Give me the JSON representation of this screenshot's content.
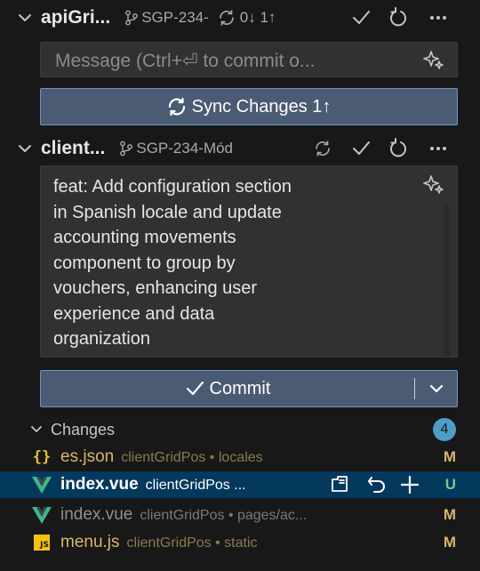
{
  "repos": [
    {
      "name": "apiGri...",
      "branch": "SGP-234-",
      "sync_status": "0↓ 1↑",
      "message_placeholder": "Message (Ctrl+⏎ to commit o...",
      "action_button": "Sync Changes 1↑"
    },
    {
      "name": "client...",
      "branch": "SGP-234-Mód",
      "message_lines": [
        "feat: Add configuration section",
        "in Spanish locale and update",
        "accounting movements",
        "component to group by",
        "vouchers, enhancing user",
        "experience and data",
        "organization"
      ],
      "action_button": "Commit"
    }
  ],
  "changes": {
    "label": "Changes",
    "count": "4",
    "files": [
      {
        "name": "es.json",
        "path": "clientGridPos • locales",
        "status": "M",
        "icon": "json-icon",
        "selected": false
      },
      {
        "name": "index.vue",
        "path": "clientGridPos ...",
        "status": "U",
        "icon": "vue-icon",
        "selected": true
      },
      {
        "name": "index.vue",
        "path": "clientGridPos • pages/ac...",
        "status": "M",
        "icon": "vue-icon",
        "selected": false
      },
      {
        "name": "menu.js",
        "path": "clientGridPos • static",
        "status": "M",
        "icon": "js-icon",
        "selected": false
      }
    ]
  },
  "colors": {
    "modified": "#d7b769",
    "untracked": "#74c991",
    "vue": "#41b883",
    "json": "#e2c12c",
    "js": "#f1c40f"
  }
}
